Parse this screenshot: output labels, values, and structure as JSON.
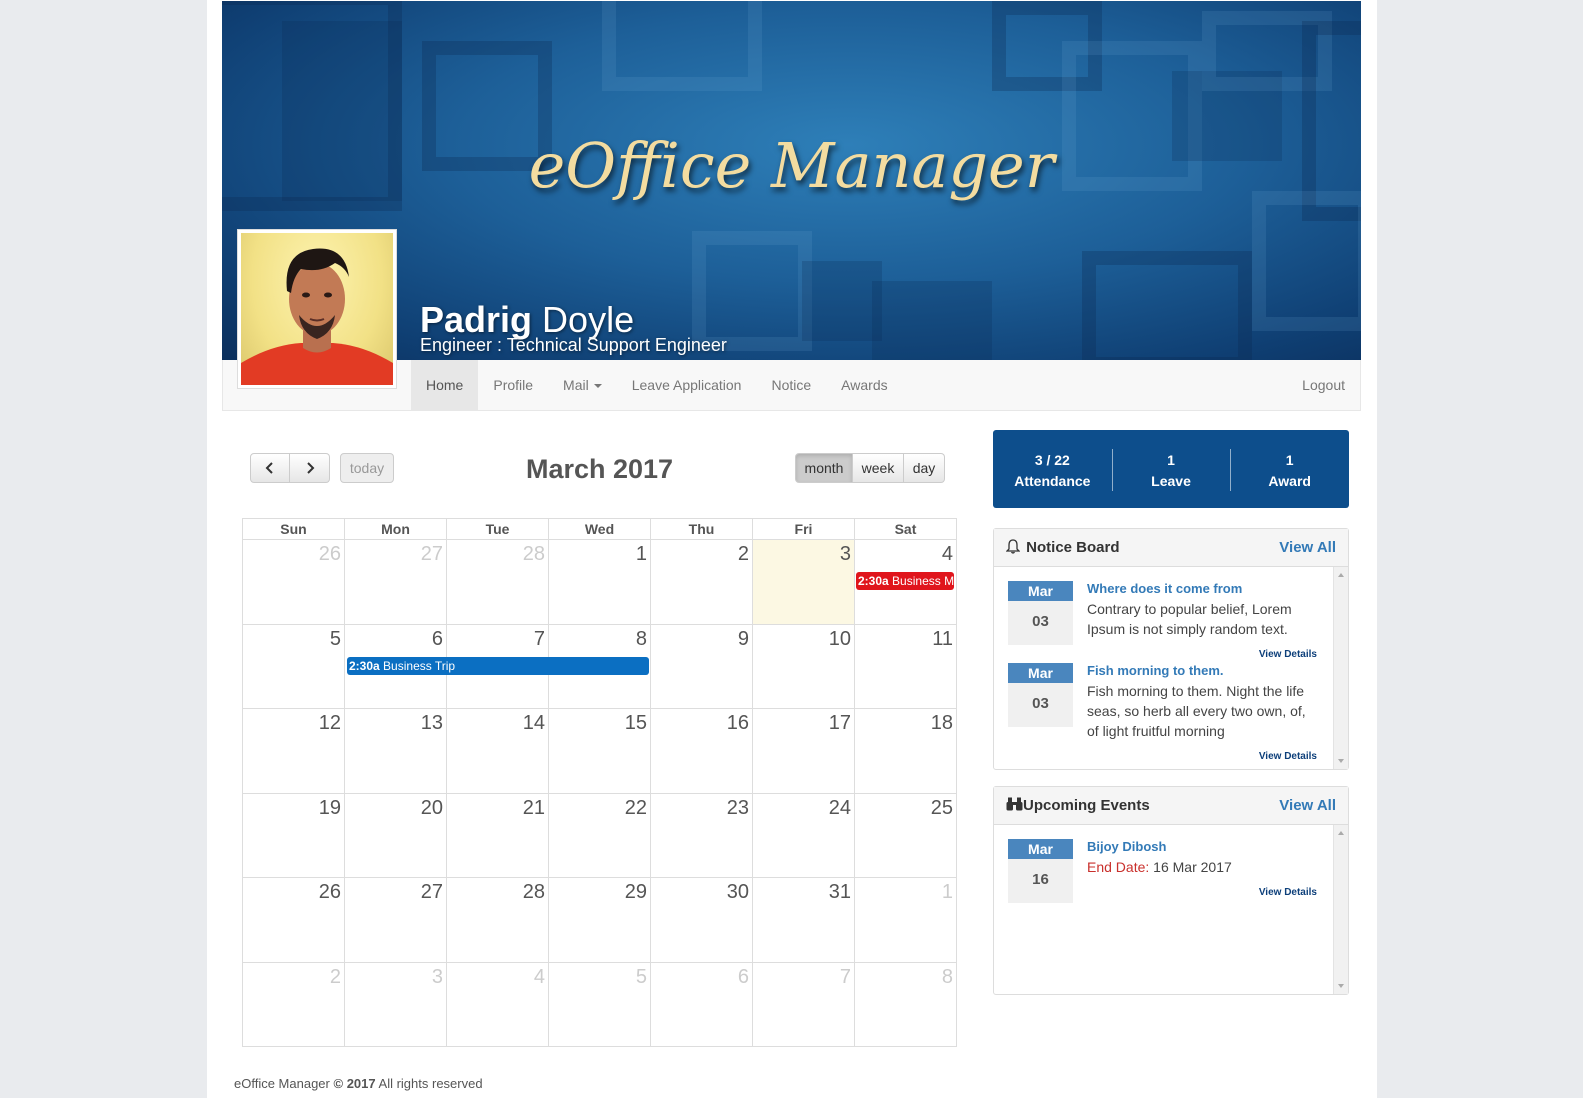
{
  "banner": {
    "app_title": "eOffice Manager",
    "first_name": "Padrig",
    "last_name": "Doyle",
    "role": "Engineer : Technical Support Engineer"
  },
  "nav": {
    "items": [
      "Home",
      "Profile",
      "Mail",
      "Leave Application",
      "Notice",
      "Awards"
    ],
    "active": "Home",
    "logout": "Logout"
  },
  "calendar": {
    "title": "March 2017",
    "today_label": "today",
    "views": [
      "month",
      "week",
      "day"
    ],
    "active_view": "month",
    "weekdays": [
      "Sun",
      "Mon",
      "Tue",
      "Wed",
      "Thu",
      "Fri",
      "Sat"
    ],
    "weeks": [
      [
        "26",
        "27",
        "28",
        "1",
        "2",
        "3",
        "4"
      ],
      [
        "5",
        "6",
        "7",
        "8",
        "9",
        "10",
        "11"
      ],
      [
        "12",
        "13",
        "14",
        "15",
        "16",
        "17",
        "18"
      ],
      [
        "19",
        "20",
        "21",
        "22",
        "23",
        "24",
        "25"
      ],
      [
        "26",
        "27",
        "28",
        "29",
        "30",
        "31",
        "1"
      ],
      [
        "2",
        "3",
        "4",
        "5",
        "6",
        "7",
        "8"
      ]
    ],
    "events": [
      {
        "time": "2:30a",
        "title": "Business M",
        "color": "#e0151c"
      },
      {
        "time": "2:30a",
        "title": "Business Trip",
        "color": "#0b6fc2"
      }
    ]
  },
  "stats": [
    {
      "value": "3 / 22",
      "label": "Attendance"
    },
    {
      "value": "1",
      "label": "Leave"
    },
    {
      "value": "1",
      "label": "Award"
    }
  ],
  "notice_board": {
    "title": "Notice Board",
    "view_all": "View All",
    "items": [
      {
        "month": "Mar",
        "day": "03",
        "title": "Where does it come from",
        "text": "Contrary to popular belief, Lorem Ipsum is not simply random text.",
        "more": "View Details"
      },
      {
        "month": "Mar",
        "day": "03",
        "title": "Fish morning to them.",
        "text": "Fish morning to them. Night the life seas, so herb all every two own, of, of light fruitful morning",
        "more": "View Details"
      }
    ]
  },
  "upcoming_events": {
    "title": "Upcoming Events",
    "view_all": "View All",
    "items": [
      {
        "month": "Mar",
        "day": "16",
        "title": "Bijoy Dibosh",
        "end_label": "End Date:",
        "end_value": "16 Mar 2017",
        "more": "View Details"
      }
    ]
  },
  "footer": {
    "brand": "eOffice Manager",
    "copyright": "© 2017",
    "rights": "All rights reserved"
  }
}
